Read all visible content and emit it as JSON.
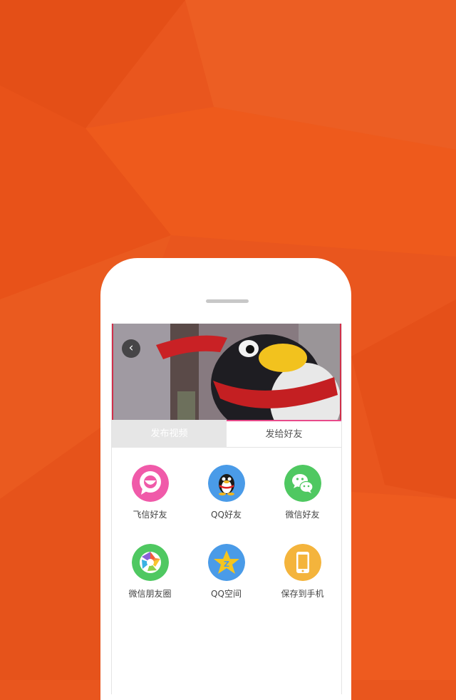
{
  "colors": {
    "background": "#e9561e",
    "feixin": "#f05aa9",
    "qq": "#4a9be8",
    "wechat": "#4fc861",
    "moments": "#4fc861",
    "qzone": "#4a9be8",
    "save": "#f4b43c",
    "tab_accent": "#e84a8a"
  },
  "video": {
    "back_icon": "chevron-left-icon"
  },
  "tabs": [
    {
      "label": "发布视频",
      "active": false
    },
    {
      "label": "发给好友",
      "active": true
    }
  ],
  "share_targets": [
    {
      "label": "飞信好友",
      "icon": "feixin-icon"
    },
    {
      "label": "QQ好友",
      "icon": "qq-penguin-icon"
    },
    {
      "label": "微信好友",
      "icon": "wechat-icon"
    },
    {
      "label": "微信朋友圈",
      "icon": "moments-aperture-icon"
    },
    {
      "label": "QQ空间",
      "icon": "qzone-star-icon"
    },
    {
      "label": "保存到手机",
      "icon": "phone-icon"
    }
  ]
}
